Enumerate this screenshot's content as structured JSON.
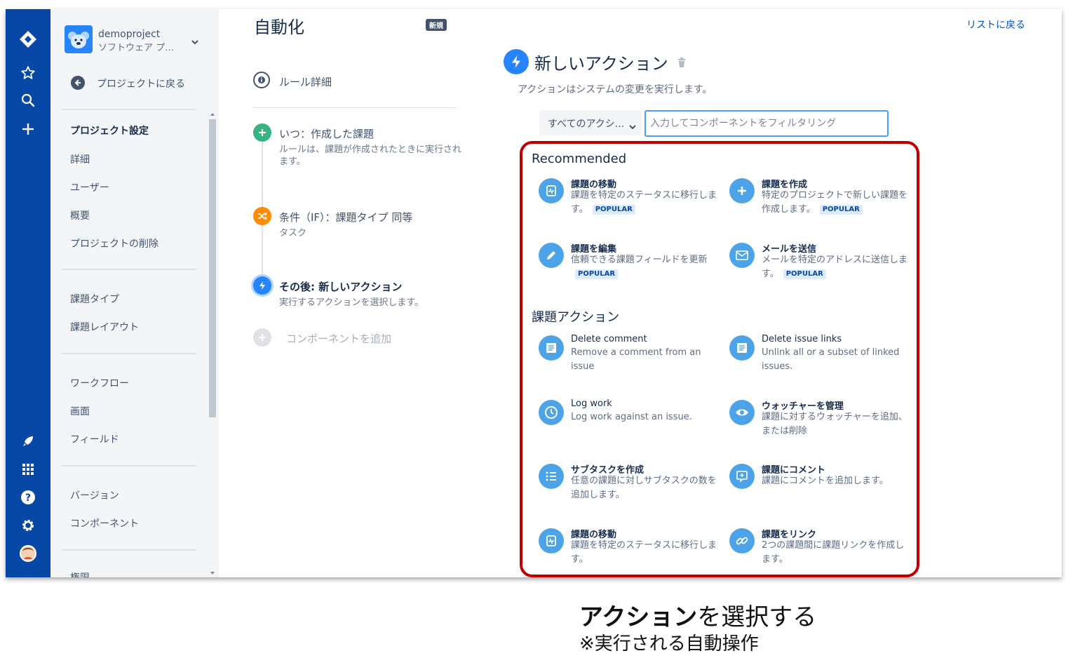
{
  "project": {
    "name": "demoproject",
    "type": "ソフトウェア プロ...",
    "back_label": "プロジェクトに戻る"
  },
  "sidebar": {
    "heading": "プロジェクト設定",
    "items": [
      "詳細",
      "ユーザー",
      "概要",
      "プロジェクトの削除",
      "課題タイプ",
      "課題レイアウト",
      "ワークフロー",
      "画面",
      "フィールド",
      "バージョン",
      "コンポーネント"
    ],
    "partial_item": "権限"
  },
  "header": {
    "title": "自動化",
    "badge": "新規",
    "back_to_list": "リストに戻る"
  },
  "rule": {
    "details_label": "ルール詳細",
    "steps": [
      {
        "title": "いつ：作成した課題",
        "desc": "ルールは、課題が作成されたときに実行されます。"
      },
      {
        "title": "条件（IF）：課題タイプ 同等",
        "desc": "タスク"
      },
      {
        "title": "その後: 新しいアクション",
        "desc": "実行するアクションを選択します。"
      }
    ],
    "add_component": "コンポーネントを追加"
  },
  "action_panel": {
    "title": "新しいアクション",
    "desc": "アクションはシステムの変更を実行します。",
    "filter_select": "すべてのアクシ...",
    "filter_placeholder": "入力してコンポーネントをフィルタリング",
    "recommended_title": "Recommended",
    "issue_actions_title": "課題アクション",
    "popular_label": "POPULAR",
    "recommended": [
      {
        "title": "課題の移動",
        "desc": "課題を特定のステータスに移行します。",
        "icon": "transition-icon"
      },
      {
        "title": "課題を作成",
        "desc": "特定のプロジェクトで新しい課題を作成します。",
        "icon": "plus-icon"
      },
      {
        "title": "課題を編集",
        "desc": "信頼できる課題フィールドを更新",
        "icon": "pencil-icon"
      },
      {
        "title": "メールを送信",
        "desc": "メールを特定のアドレスに送信します。",
        "icon": "mail-icon"
      }
    ],
    "issue_actions": [
      {
        "title": "Delete comment",
        "desc": "Remove a comment from an issue",
        "icon": "comment-doc-icon"
      },
      {
        "title": "Delete issue links",
        "desc": "Unlink all or a subset of linked issues.",
        "icon": "doc-lines-icon"
      },
      {
        "title": "Log work",
        "desc": "Log work against an issue.",
        "icon": "clock-icon"
      },
      {
        "title": "ウォッチャーを管理",
        "desc": "課題に対するウォッチャーを追加、または削除",
        "icon": "eye-icon"
      },
      {
        "title": "サブタスクを作成",
        "desc": "任意の課題に対しサブタスクの数を追加します。",
        "icon": "list-icon"
      },
      {
        "title": "課題にコメント",
        "desc": "課題にコメントを追加します。",
        "icon": "comment-add-icon"
      },
      {
        "title": "課題の移動",
        "desc": "課題を特定のステータスに移行します。",
        "icon": "transition-icon"
      },
      {
        "title": "課題をリンク",
        "desc": "2つの課題間に課題リンクを作成します。",
        "icon": "link-icon"
      }
    ]
  },
  "caption": {
    "bold": "アクション",
    "rest": "を選択する",
    "sub": "※実行される自動操作"
  },
  "colors": {
    "nav": "#0747a6",
    "accent": "#2684ff",
    "highlight": "#c00000",
    "green": "#36b37e",
    "orange": "#ff8b00"
  }
}
